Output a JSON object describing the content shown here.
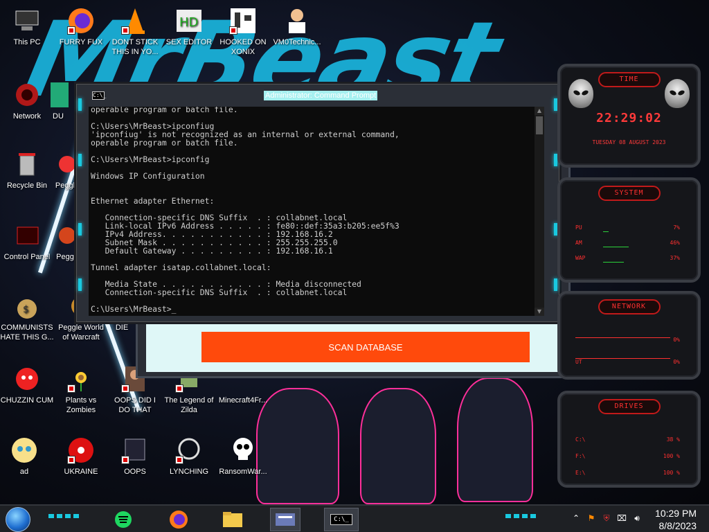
{
  "desktop": {
    "icons": [
      {
        "label": "This PC"
      },
      {
        "label": "FURRY FUX"
      },
      {
        "label": "DONT STICK THIS IN YO..."
      },
      {
        "label": "SEX EDITOR"
      },
      {
        "label": "HOOKED ON XONIX"
      },
      {
        "label": "VM0Technic..."
      },
      {
        "label": "Network"
      },
      {
        "label": "DU"
      },
      {
        "label": "Recycle Bin"
      },
      {
        "label": "Peggl"
      },
      {
        "label": "Control Panel"
      },
      {
        "label": "Pegg"
      },
      {
        "label": "COMMUNISTS HATE THIS G..."
      },
      {
        "label": "Peggle World of Warcraft"
      },
      {
        "label": "DIE"
      },
      {
        "label": "CHUZZIN CUM"
      },
      {
        "label": "Plants vs Zombies"
      },
      {
        "label": "OOPS DID I DO THAT"
      },
      {
        "label": "The Legend of Zilda"
      },
      {
        "label": "Minecraft4Fr..."
      },
      {
        "label": "ad"
      },
      {
        "label": "UKRAINE"
      },
      {
        "label": "OOPS"
      },
      {
        "label": "LYNCHING"
      },
      {
        "label": "RansomWar..."
      }
    ]
  },
  "background_window": {
    "button_label": "SCAN DATABASE"
  },
  "cmd": {
    "title": "Administrator: Command Prompt",
    "icon_text": "C:\\_",
    "lines": "operable program or batch file.\n\nC:\\Users\\MrBeast>ipconfiug\n'ipconfiug' is not recognized as an internal or external command,\noperable program or batch file.\n\nC:\\Users\\MrBeast>ipconfig\n\nWindows IP Configuration\n\n\nEthernet adapter Ethernet:\n\n   Connection-specific DNS Suffix  . : collabnet.local\n   Link-local IPv6 Address . . . . . : fe80::def:35a3:b205:ee5f%3\n   IPv4 Address. . . . . . . . . . . : 192.168.16.2\n   Subnet Mask . . . . . . . . . . . : 255.255.255.0\n   Default Gateway . . . . . . . . . : 192.168.16.1\n\nTunnel adapter isatap.collabnet.local:\n\n   Media State . . . . . . . . . . . : Media disconnected\n   Connection-specific DNS Suffix  . : collabnet.local\n\nC:\\Users\\MrBeast>_"
  },
  "widgets": {
    "time": {
      "header": "TIME",
      "clock": "22:29:02",
      "date": "TUESDAY 08 AUGUST 2023"
    },
    "system": {
      "header": "SYSTEM",
      "rows": [
        {
          "label": "PU",
          "value": "7%",
          "level": 0.07
        },
        {
          "label": "AM",
          "value": "46%",
          "level": 0.46
        },
        {
          "label": "WAP",
          "value": "37%",
          "level": 0.37
        }
      ]
    },
    "network": {
      "header": "NETWORK",
      "rows": [
        {
          "label": "",
          "value": "0%"
        },
        {
          "label": "UT",
          "value": "0%"
        }
      ]
    },
    "drives": {
      "header": "DRIVES",
      "rows": [
        {
          "label": "C:\\",
          "value": "38 %"
        },
        {
          "label": "F:\\",
          "value": "100 %"
        },
        {
          "label": "E:\\",
          "value": "100 %"
        }
      ]
    }
  },
  "taskbar": {
    "apps": [
      "spotify",
      "firefox",
      "file-explorer",
      "control-panel",
      "command-prompt"
    ],
    "cmd_icon_text": "C:\\_",
    "time": "10:29 PM",
    "date": "8/8/2023"
  },
  "colors": {
    "accent_cyan": "#19c9e0",
    "accent_red": "#ff3030",
    "scan_button": "#ff4a0c"
  }
}
